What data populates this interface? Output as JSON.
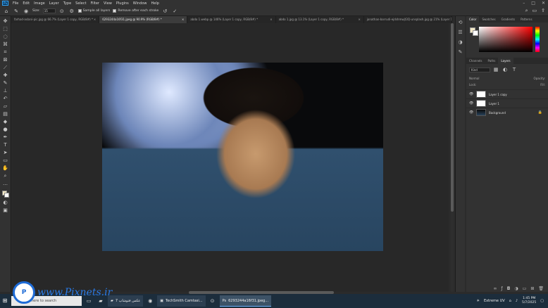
{
  "menubar": {
    "logo": "Ps",
    "items": [
      "File",
      "Edit",
      "Image",
      "Layer",
      "Type",
      "Select",
      "Filter",
      "View",
      "Plugins",
      "Window",
      "Help"
    ],
    "controls": [
      "–",
      "□",
      "✕"
    ]
  },
  "options": {
    "size_label": "Size:",
    "size_value": "15",
    "sample_all_layers": "Sample all layers",
    "remove_after_stroke": "Remove after each stroke"
  },
  "tabs": [
    {
      "label": "farhad-aslani-pic.jpg @ 66.7% (Layer 1 copy, RGB/8#) *"
    },
    {
      "label": "6293244a16f31.jpeg @ 90.9% (RGB/8#) *",
      "active": true
    },
    {
      "label": "abdo 1.webp @ 146% (Layer 1 copy, RGB/8#) *"
    },
    {
      "label": "abdo 1.jpg @ 13.1% (Layer 1 copy, RGB/8#) *"
    },
    {
      "label": "jonathan-borrudi-ejdshmwjt3Q-unsplash.jpg @ 21% (Layer 1, RGB/8#) *"
    }
  ],
  "panels": {
    "color_tabs": [
      "Color",
      "Swatches",
      "Gradients",
      "Patterns"
    ],
    "layer_tabs": [
      "Channels",
      "Paths",
      "Layers"
    ],
    "kind": "Kind",
    "blend_left": "Normal",
    "blend_right": "Opacity:",
    "lock_label": "Lock:",
    "fill_label": "Fill:",
    "layers": [
      {
        "name": "Layer 1 copy",
        "selected": false
      },
      {
        "name": "Layer 1",
        "selected": false
      },
      {
        "name": "Background",
        "selected": false
      }
    ]
  },
  "taskbar": {
    "search_placeholder": "here to search",
    "apps": [
      {
        "label": "عکس فتوشاپ 7"
      },
      {
        "label": "TechSmith Camtasi..."
      },
      {
        "label": "6293244a16f31.jpeg..."
      }
    ],
    "weather": "Extreme UV",
    "time": "1:45 PM",
    "date": "5/7/2025"
  },
  "watermark": {
    "text": "www.Pixnets.ir"
  }
}
